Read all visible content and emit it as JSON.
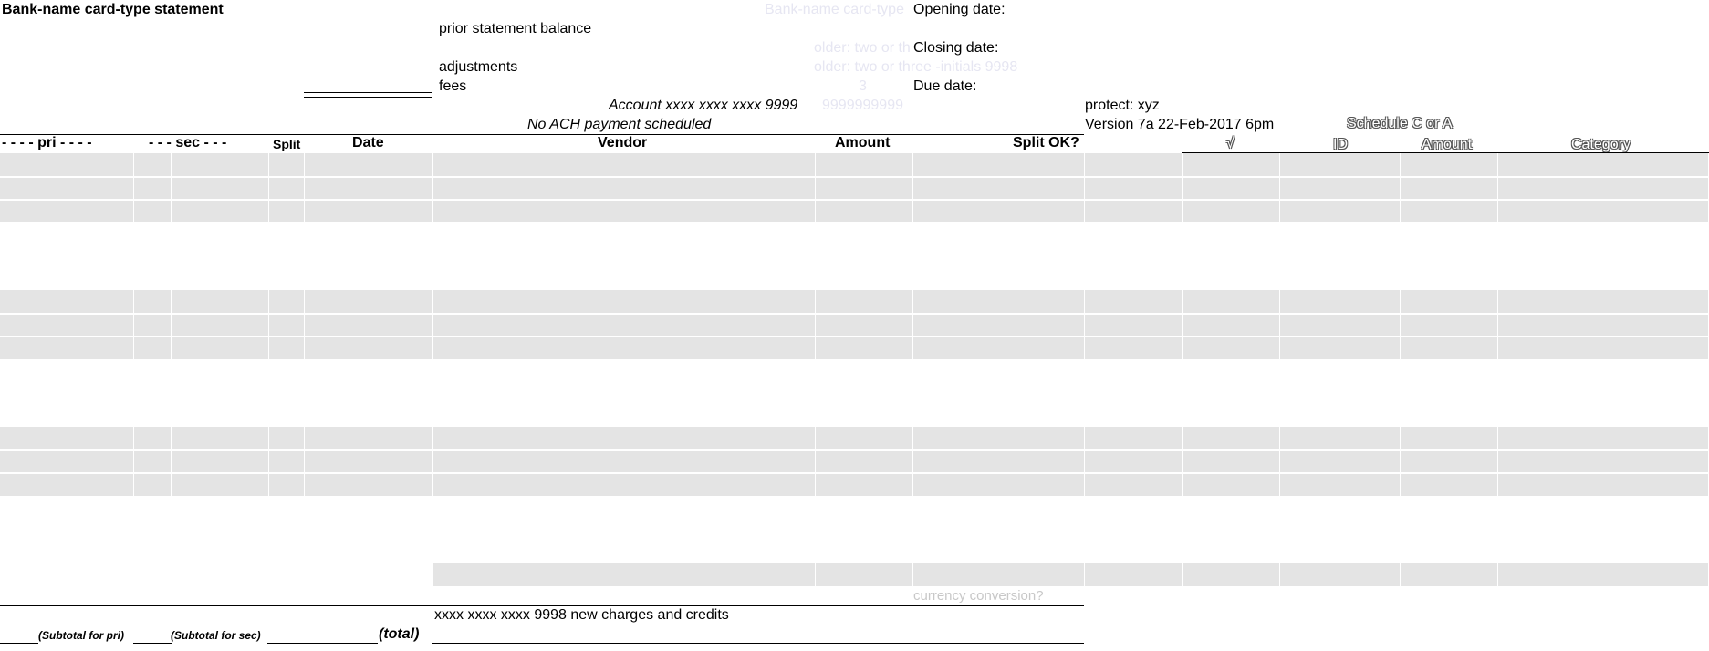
{
  "header": {
    "title": "Bank-name card-type statement",
    "ghost_title": "Bank-name card-type",
    "ghost_holder1": "older: two or th",
    "ghost_holder2": "older: two or three -initials 9998",
    "ghost_num": "3",
    "ghost_acct": "9999999999"
  },
  "summary": {
    "prior_balance": "prior statement balance",
    "adjustments": "adjustments",
    "fees": "fees",
    "opening_date": "Opening date:",
    "closing_date": "Closing date:",
    "due_date": "Due date:"
  },
  "account": {
    "line": "Account xxxx xxxx xxxx 9999",
    "ach": "No ACH payment scheduled"
  },
  "meta": {
    "protect": "protect: xyz",
    "version": "Version 7a 22-Feb-2017 6pm"
  },
  "schedule": {
    "title": "Schedule C or A",
    "check": "√",
    "id": "ID",
    "amount": "Amount",
    "category": "Category"
  },
  "columns": {
    "pri": "- - - - pri - - - -",
    "sec": "- - - sec - - -",
    "split": "Split",
    "date": "Date",
    "vendor": "Vendor",
    "amount": "Amount",
    "split_ok": "Split OK?"
  },
  "footer": {
    "currency": "currency conversion?",
    "new_charges": "xxxx xxxx xxxx 9998 new charges and credits",
    "subtotal_pri": "(Subtotal for pri)",
    "subtotal_sec": "(Subtotal for sec)",
    "total": "(total)"
  }
}
